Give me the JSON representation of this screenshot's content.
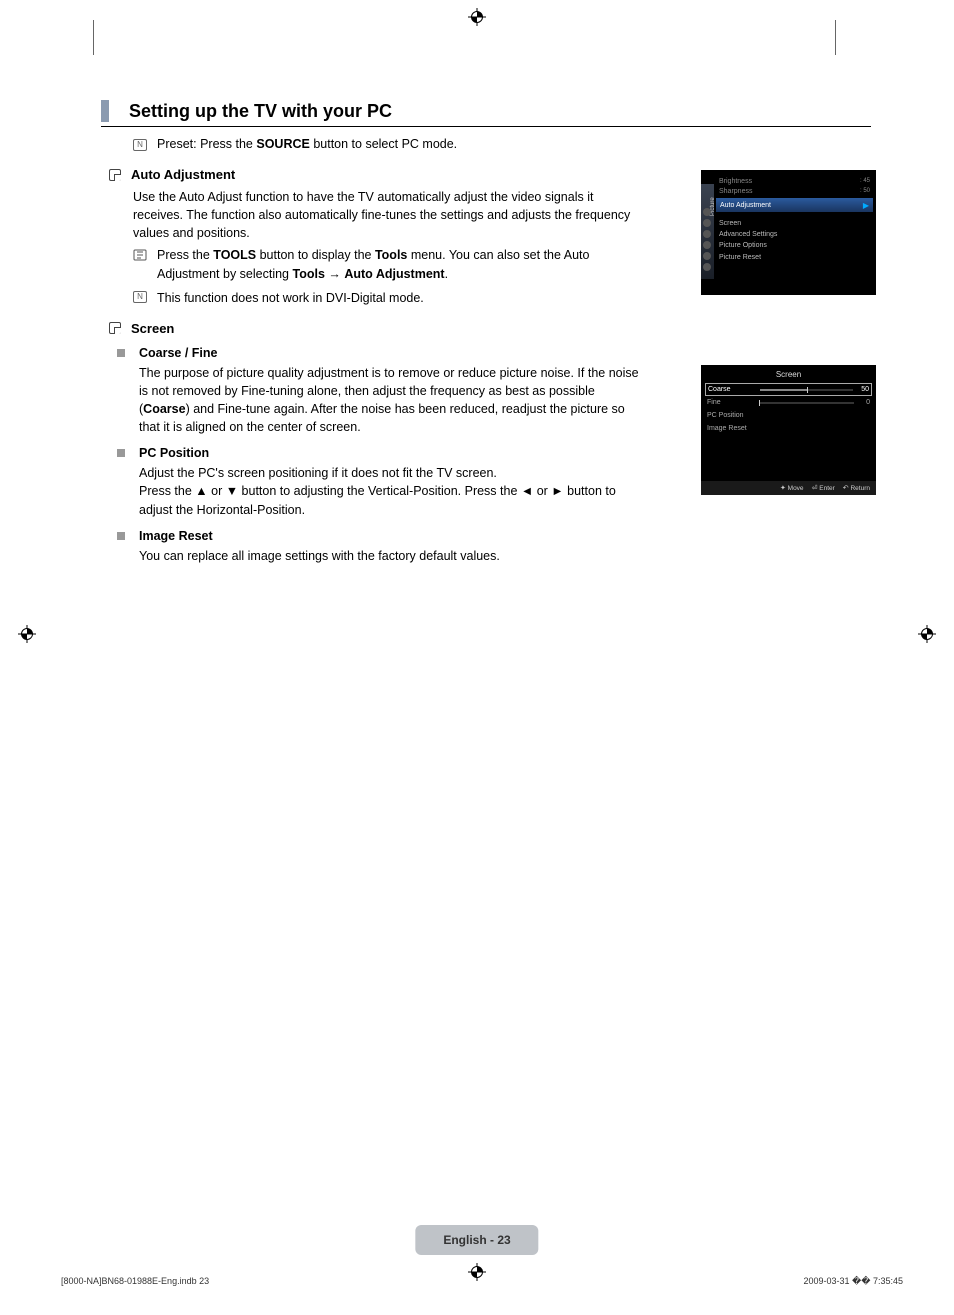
{
  "heading": "Setting up the TV with your PC",
  "preset_note_pre": "Preset: Press the ",
  "preset_note_bold": "SOURCE",
  "preset_note_post": " button to select PC mode.",
  "auto_adjustment": {
    "title": "Auto Adjustment",
    "body": "Use the Auto Adjust function to have the TV automatically adjust the video signals it receives. The function also automatically fine-tunes the settings and adjusts the frequency values and positions.",
    "tools_pre": "Press the ",
    "tools_b1": "TOOLS",
    "tools_mid": " button to display the ",
    "tools_b2": "Tools",
    "tools_mid2": " menu. You can also set the Auto Adjustment by selecting ",
    "tools_b3": "Tools",
    "tools_arrow": " → ",
    "tools_b4": "Auto Adjustment",
    "tools_post": ".",
    "dvi_note": "This function does not work in DVI-Digital mode."
  },
  "screen": {
    "title": "Screen",
    "coarse_fine": {
      "title": "Coarse / Fine",
      "body_pre": "The purpose of picture quality adjustment is to remove or reduce picture noise. If the noise is not removed by Fine-tuning alone, then adjust the frequency as best as possible (",
      "body_b": "Coarse",
      "body_post": ") and Fine-tune again. After the noise has been reduced, readjust the picture so that it is aligned on the center of screen."
    },
    "pc_position": {
      "title": "PC Position",
      "line1": "Adjust the PC's screen positioning if it does not fit the TV screen.",
      "line2": "Press the ▲ or ▼ button to adjusting the Vertical-Position. Press the ◄ or ► button to adjust the Horizontal-Position."
    },
    "image_reset": {
      "title": "Image Reset",
      "body": "You can replace all image settings with the factory default values."
    }
  },
  "osd1": {
    "sidebar_label": "Picture",
    "brightness_k": "Brightness",
    "brightness_v": ": 45",
    "sharpness_k": "Sharpness",
    "sharpness_v": ": 50",
    "highlight": "Auto Adjustment",
    "items": [
      "Screen",
      "Advanced Settings",
      "Picture Options",
      "Picture Reset"
    ]
  },
  "osd2": {
    "title": "Screen",
    "coarse_label": "Coarse",
    "coarse_val": "50",
    "fine_label": "Fine",
    "fine_val": "0",
    "pc_pos": "PC Position",
    "img_reset": "Image Reset",
    "footer_move": "Move",
    "footer_enter": "Enter",
    "footer_return": "Return"
  },
  "page_badge": "English - 23",
  "footer_left": "[8000-NA]BN68-01988E-Eng.indb   23",
  "footer_right": "2009-03-31   �� 7:35:45"
}
